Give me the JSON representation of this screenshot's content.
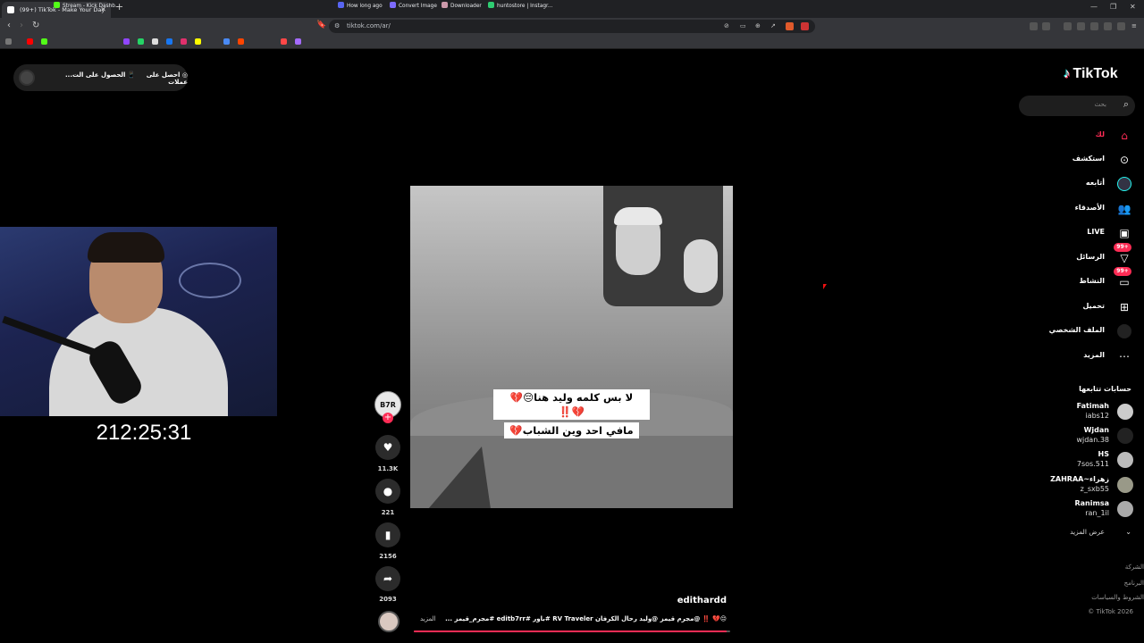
{
  "browser": {
    "tab_title": "(99+) TikTok - Make Your Day",
    "url": "tiktok.com/ar/",
    "bookmarks": [
      "Stream - Kick Dashb...",
      "How long ago",
      "Convert Image",
      "Downloader",
      "huntostore | Instagr..."
    ]
  },
  "top_pill": {
    "get_coins": "احصل على عملات",
    "get_app": "الحصول على الت..."
  },
  "stream": {
    "timer": "212:25:31"
  },
  "video": {
    "caption_line1": "لا بس كلمه وليد هنا😔💔💔‼️",
    "caption_line2": "مافي احد وين الشباب💔",
    "author_avatar_text": "B7R",
    "author": "edithardd",
    "description": "😔💔 ‼️ @مجرم قيمز @وليد رحال الكرفان RV Traveler #باور #editb7rr #مجرم_قيمز ...",
    "more_label": "المزيد",
    "likes": "11.3K",
    "comments": "221",
    "saves": "2156",
    "shares": "2093",
    "progress_fraction": 0.99,
    "colors": {
      "accent": "#fe2c55"
    }
  },
  "sidebar": {
    "logo": "TikTok",
    "search_placeholder": "بحث",
    "nav": [
      {
        "label": "لك",
        "icon": "home-icon"
      },
      {
        "label": "استكشف",
        "icon": "compass-icon"
      },
      {
        "label": "أتابعه",
        "icon": "following-icon"
      },
      {
        "label": "الأصدقاء",
        "icon": "friends-icon"
      },
      {
        "label": "LIVE",
        "icon": "live-icon"
      },
      {
        "label": "الرسائل",
        "icon": "messages-icon",
        "badge": "+99"
      },
      {
        "label": "النشاط",
        "icon": "activity-icon",
        "badge": "+99"
      },
      {
        "label": "تحميل",
        "icon": "upload-icon"
      },
      {
        "label": "الملف الشخصي",
        "icon": "profile-icon"
      },
      {
        "label": "المزيد",
        "icon": "more-icon"
      }
    ],
    "following_title": "حسابات تتابعها",
    "following": [
      {
        "name": "Fatimah",
        "handle": "iabs12"
      },
      {
        "name": "Wjdan",
        "handle": "wjdan.38"
      },
      {
        "name": "HS",
        "handle": "7sos.511"
      },
      {
        "name": "ZAHRAA~زهراء",
        "handle": "z_sxb55"
      },
      {
        "name": "Ranimsa",
        "handle": "ran_1il"
      }
    ],
    "see_more": "عرض المزيد",
    "footer": [
      "الشركة",
      "البرنامج",
      "الشروط والسياسات"
    ],
    "copyright": "© TikTok 2026"
  }
}
